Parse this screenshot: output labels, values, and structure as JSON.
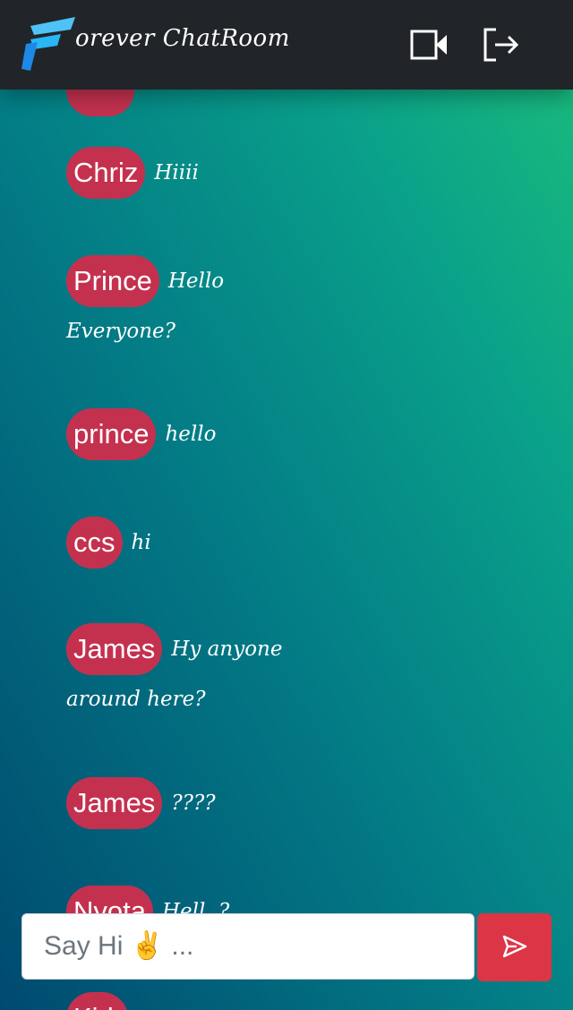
{
  "navbar": {
    "brand_text": "orever ChatRoom",
    "logo_icon": "brand-f-logo",
    "video_icon": "video-camera-icon",
    "logout_icon": "logout-icon",
    "colors": {
      "background": "#212529",
      "logo_light": "#4fc3f7",
      "logo_dark": "#1e88e5"
    }
  },
  "messages": [
    {
      "name": "Chriz",
      "text": "Hiiii"
    },
    {
      "name": "Prince",
      "text": "Hello Everyone?"
    },
    {
      "name": "prince",
      "text": "hello"
    },
    {
      "name": "ccs",
      "text": "hi"
    },
    {
      "name": "James",
      "text": "Hy anyone around here?"
    },
    {
      "name": "James",
      "text": "????"
    },
    {
      "name": "Nyota",
      "text": "Hell..?"
    },
    {
      "name": "Kirk",
      "text": ""
    }
  ],
  "composer": {
    "placeholder": "Say Hi ✌️ ...",
    "value": "",
    "send_icon": "send-icon"
  },
  "colors": {
    "name_badge": "#c4314f",
    "send_button": "#dc3545",
    "gradient": [
      "#004a70",
      "#037d86",
      "#0aa18a",
      "#1bbd7b"
    ]
  }
}
